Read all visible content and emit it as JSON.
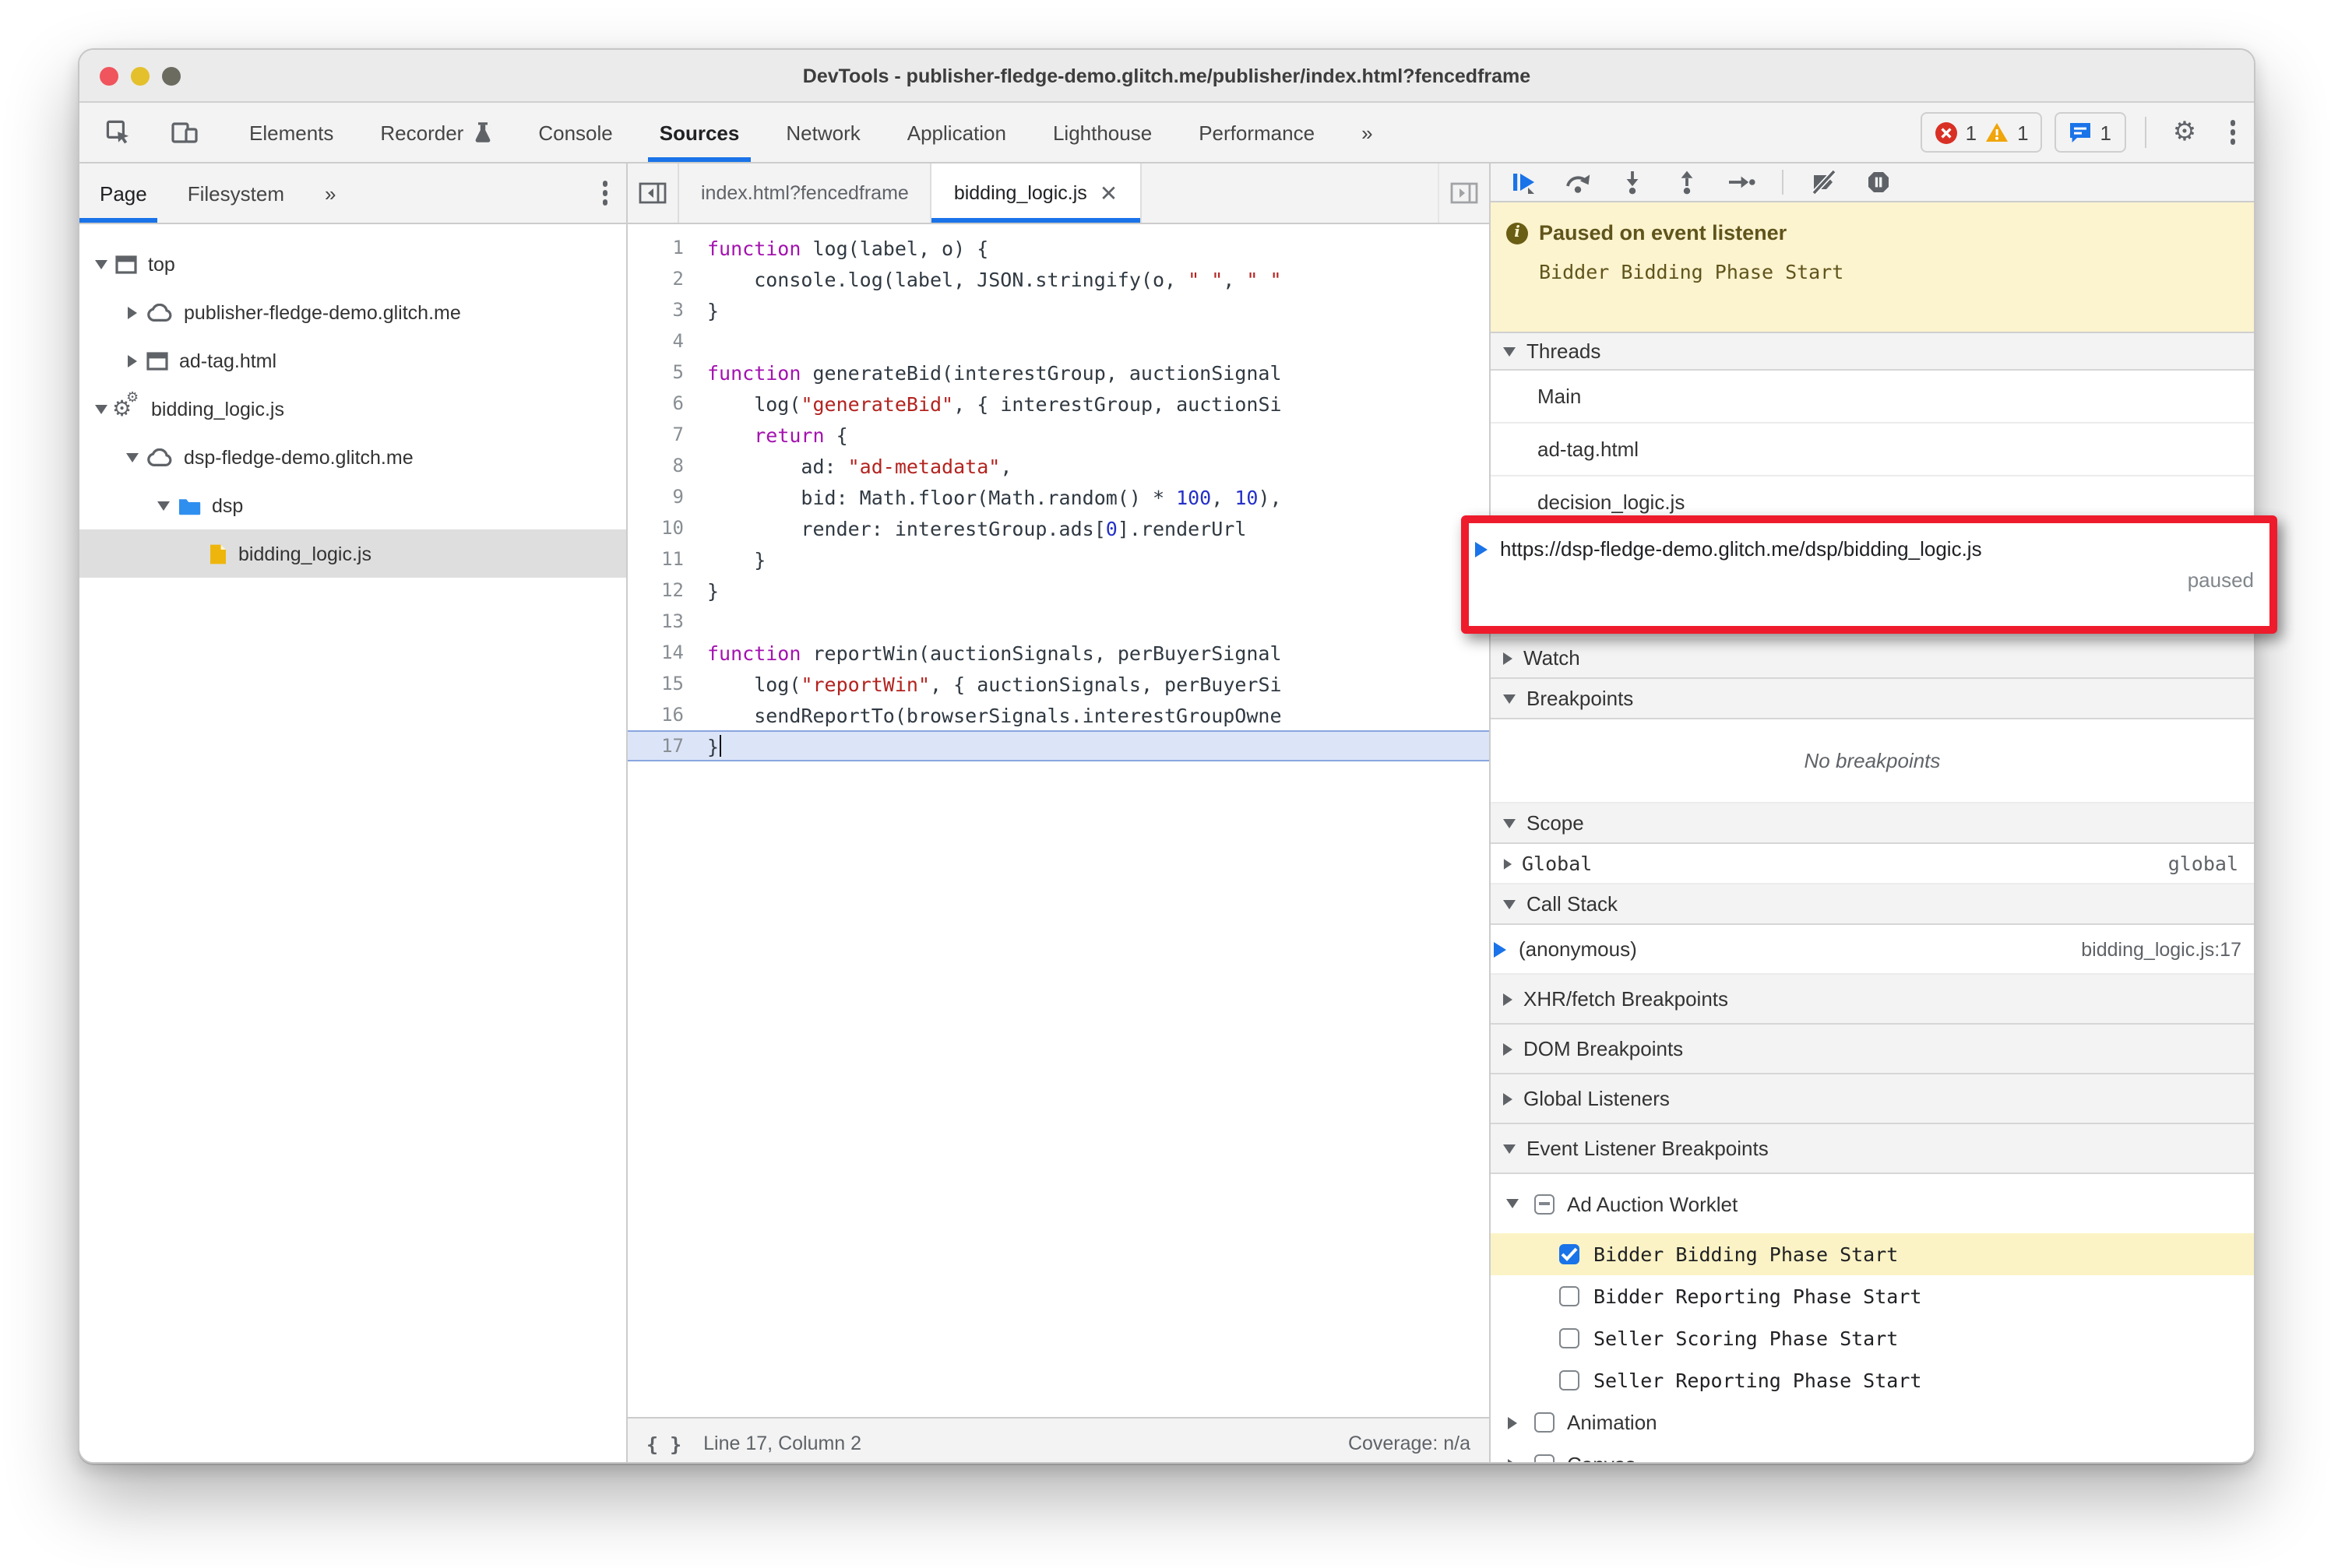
{
  "theme": {
    "accent": "#1a73e8",
    "annotation_red": "#ee1b2c",
    "banner_bg": "#fcf3cf",
    "banner_fg": "#5f541b",
    "highlight_yellow": "#fbf3c5",
    "paused_line_blue": "#dce5f8",
    "titlebar_bg": "#ebebeb",
    "error_red": "#d93025",
    "warning_yellow": "#f0a50a"
  },
  "window": {
    "title": "DevTools - publisher-fledge-demo.glitch.me/publisher/index.html?fencedframe"
  },
  "toolbar": {
    "left_icons": [
      {
        "icon": "inspect-icon"
      },
      {
        "icon": "device-toolbar-icon"
      }
    ],
    "tabs": [
      {
        "label": "Elements"
      },
      {
        "label": "Recorder",
        "trailing_icon": "beaker-icon"
      },
      {
        "label": "Console"
      },
      {
        "label": "Sources",
        "active": true
      },
      {
        "label": "Network"
      },
      {
        "label": "Application"
      },
      {
        "label": "Lighthouse"
      },
      {
        "label": "Performance"
      },
      {
        "label": "»"
      }
    ],
    "badges": {
      "errors": "1",
      "warnings": "1",
      "issues": "1"
    }
  },
  "sidebar": {
    "tabs": [
      {
        "label": "Page",
        "active": true
      },
      {
        "label": "Filesystem"
      },
      {
        "label": "»"
      }
    ],
    "tree": [
      {
        "depth": 0,
        "arrow": "down",
        "icon": "frame-icon",
        "label": "top"
      },
      {
        "depth": 1,
        "arrow": "right",
        "icon": "cloud-icon",
        "label": "publisher-fledge-demo.glitch.me"
      },
      {
        "depth": 1,
        "arrow": "right",
        "icon": "frame-icon",
        "label": "ad-tag.html"
      },
      {
        "depth": 0,
        "arrow": "down",
        "icon": "worklet-icon",
        "label": "bidding_logic.js"
      },
      {
        "depth": 1,
        "arrow": "down",
        "icon": "cloud-icon",
        "label": "dsp-fledge-demo.glitch.me"
      },
      {
        "depth": 2,
        "arrow": "down",
        "icon": "folder-icon",
        "label": "dsp"
      },
      {
        "depth": 3,
        "arrow": "none",
        "icon": "file-js-icon",
        "label": "bidding_logic.js",
        "selected": true
      }
    ]
  },
  "editor": {
    "tabs": [
      {
        "label": "index.html?fencedframe"
      },
      {
        "label": "bidding_logic.js",
        "active": true,
        "closable": true
      }
    ],
    "code_lines": [
      {
        "n": "1",
        "tokens": [
          [
            "kw",
            "function"
          ],
          [
            "pl",
            " log(label, o) {"
          ]
        ]
      },
      {
        "n": "2",
        "tokens": [
          [
            "pl",
            "    console.log(label, JSON.stringify(o, "
          ],
          [
            "str",
            "\" \""
          ],
          [
            "pl",
            ", "
          ],
          [
            "str",
            "\" \""
          ]
        ]
      },
      {
        "n": "3",
        "tokens": [
          [
            "pl",
            "}"
          ]
        ]
      },
      {
        "n": "4",
        "tokens": []
      },
      {
        "n": "5",
        "tokens": [
          [
            "kw",
            "function"
          ],
          [
            "pl",
            " generateBid(interestGroup, auctionSignal"
          ]
        ]
      },
      {
        "n": "6",
        "tokens": [
          [
            "pl",
            "    log("
          ],
          [
            "str",
            "\"generateBid\""
          ],
          [
            "pl",
            ", { interestGroup, auctionSi"
          ]
        ]
      },
      {
        "n": "7",
        "tokens": [
          [
            "pl",
            "    "
          ],
          [
            "kw",
            "return"
          ],
          [
            "pl",
            " {"
          ]
        ]
      },
      {
        "n": "8",
        "tokens": [
          [
            "pl",
            "        ad: "
          ],
          [
            "str",
            "\"ad-metadata\""
          ],
          [
            "pl",
            ","
          ]
        ]
      },
      {
        "n": "9",
        "tokens": [
          [
            "pl",
            "        bid: Math.floor(Math.random() * "
          ],
          [
            "num",
            "100"
          ],
          [
            "pl",
            ", "
          ],
          [
            "num",
            "10"
          ],
          [
            "pl",
            "),"
          ]
        ]
      },
      {
        "n": "10",
        "tokens": [
          [
            "pl",
            "        render: interestGroup.ads["
          ],
          [
            "num",
            "0"
          ],
          [
            "pl",
            "].renderUrl"
          ]
        ]
      },
      {
        "n": "11",
        "tokens": [
          [
            "pl",
            "    }"
          ]
        ]
      },
      {
        "n": "12",
        "tokens": [
          [
            "pl",
            "}"
          ]
        ]
      },
      {
        "n": "13",
        "tokens": []
      },
      {
        "n": "14",
        "tokens": [
          [
            "kw",
            "function"
          ],
          [
            "pl",
            " reportWin(auctionSignals, perBuyerSignal"
          ]
        ]
      },
      {
        "n": "15",
        "tokens": [
          [
            "pl",
            "    log("
          ],
          [
            "str",
            "\"reportWin\""
          ],
          [
            "pl",
            ", { auctionSignals, perBuyerSi"
          ]
        ]
      },
      {
        "n": "16",
        "tokens": [
          [
            "pl",
            "    sendReportTo(browserSignals.interestGroupOwne"
          ]
        ]
      },
      {
        "n": "17",
        "tokens": [
          [
            "pl",
            "}"
          ]
        ],
        "paused": true
      }
    ],
    "status": {
      "line_col": "Line 17, Column 2",
      "coverage": "Coverage: n/a"
    }
  },
  "debugger": {
    "banner": {
      "title": "Paused on event listener",
      "subtitle": "Bidder Bidding Phase Start"
    },
    "sections": {
      "threads": "Threads",
      "watch": "Watch",
      "breakpoints": "Breakpoints",
      "scope": "Scope",
      "call_stack": "Call Stack",
      "xhr": "XHR/fetch Breakpoints",
      "dom": "DOM Breakpoints",
      "global_listeners": "Global Listeners",
      "event_listener": "Event Listener Breakpoints"
    },
    "threads": [
      {
        "label": "Main"
      },
      {
        "label": "ad-tag.html"
      },
      {
        "label": "decision_logic.js"
      }
    ],
    "paused_thread": {
      "url": "https://dsp-fledge-demo.glitch.me/dsp/bidding_logic.js",
      "status": "paused"
    },
    "breakpoints_empty": "No breakpoints",
    "scope": {
      "label": "Global",
      "value": "global"
    },
    "call_stack": {
      "label": "(anonymous)",
      "location": "bidding_logic.js:17"
    },
    "event_listener_breakpoints": [
      {
        "label": "Ad Auction Worklet",
        "state": "indeterminate",
        "expanded": true,
        "children": [
          {
            "label": "Bidder Bidding Phase Start",
            "checked": true,
            "highlighted": true
          },
          {
            "label": "Bidder Reporting Phase Start",
            "checked": false
          },
          {
            "label": "Seller Scoring Phase Start",
            "checked": false
          },
          {
            "label": "Seller Reporting Phase Start",
            "checked": false
          }
        ]
      },
      {
        "label": "Animation",
        "state": "unchecked",
        "expanded": false,
        "children": []
      },
      {
        "label": "Canvas",
        "state": "unchecked",
        "expanded": false,
        "children": []
      }
    ]
  }
}
